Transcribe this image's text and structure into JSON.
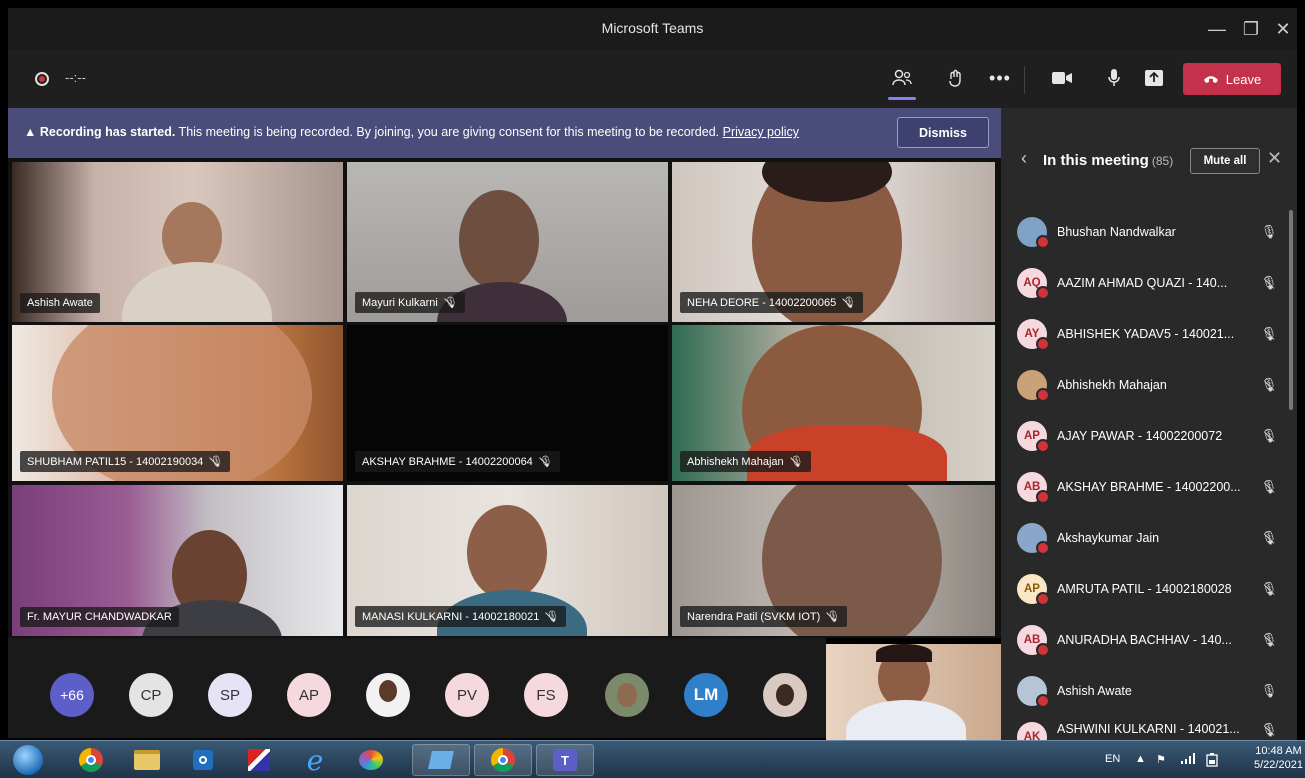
{
  "window": {
    "title": "Microsoft Teams",
    "controls": [
      "—",
      "❐",
      "✕"
    ]
  },
  "meeting_bar": {
    "timer": "--:--",
    "icons": [
      "participants-icon",
      "reactions-icon",
      "more-options-icon",
      "camera-icon",
      "microphone-icon",
      "share-screen-icon"
    ],
    "leave_label": "Leave",
    "leave_color": "#c4314b"
  },
  "banner": {
    "bold": "Recording has started.",
    "text": " This meeting is being recorded. By joining, you are giving consent for this meeting to be recorded. ",
    "link": "Privacy policy",
    "dismiss": "Dismiss",
    "color": "#4a4c7a"
  },
  "tiles": [
    {
      "name": "Ashish Awate",
      "muted": false
    },
    {
      "name": "Mayuri Kulkarni",
      "muted": true
    },
    {
      "name": "NEHA DEORE - 14002200065",
      "muted": true
    },
    {
      "name": "SHUBHAM PATIL15 - 14002190034",
      "muted": true
    },
    {
      "name": "AKSHAY BRAHME - 14002200064",
      "muted": true
    },
    {
      "name": "Abhishekh Mahajan",
      "muted": true
    },
    {
      "name": "Fr. MAYUR CHANDWADKAR",
      "muted": false
    },
    {
      "name": "MANASI KULKARNI - 14002180021",
      "muted": true
    },
    {
      "name": "Narendra Patil (SVKM IOT)",
      "muted": true
    }
  ],
  "avatar_strip": [
    {
      "label": "+66",
      "color": "#5b5fc7"
    },
    {
      "label": "CP",
      "color": "#e4e4e4"
    },
    {
      "label": "SP",
      "color": "#e6e3f7"
    },
    {
      "label": "AP",
      "color": "#f6d9de"
    },
    {
      "label": "",
      "color": "#f2f2f2"
    },
    {
      "label": "PV",
      "color": "#f6d9de"
    },
    {
      "label": "FS",
      "color": "#f6d9de"
    },
    {
      "label": "",
      "color": "#7a8a6a"
    },
    {
      "label": "LM",
      "color": "#2f80c9"
    },
    {
      "label": "",
      "color": "#d9c9c0"
    }
  ],
  "panel": {
    "title": "In this meeting",
    "count": "(85)",
    "mute_all": "Mute all",
    "participants": [
      {
        "initials": "",
        "name": "Bhushan Nandwalkar",
        "muted": false,
        "color": "#7fa2c7"
      },
      {
        "initials": "AQ",
        "name": "AAZIM AHMAD QUAZI - 140...",
        "muted": true,
        "color": "#f6d9de"
      },
      {
        "initials": "AY",
        "name": "ABHISHEK YADAV5 - 140021...",
        "muted": true,
        "color": "#f6d9de"
      },
      {
        "initials": "",
        "name": "Abhishekh Mahajan",
        "muted": true,
        "color": "#c9a27a"
      },
      {
        "initials": "AP",
        "name": "AJAY PAWAR - 14002200072",
        "muted": true,
        "color": "#f6d9de"
      },
      {
        "initials": "AB",
        "name": "AKSHAY BRAHME - 14002200...",
        "muted": true,
        "color": "#f6d9de"
      },
      {
        "initials": "",
        "name": "Akshaykumar Jain",
        "muted": true,
        "color": "#8aa7c9"
      },
      {
        "initials": "AP",
        "name": "AMRUTA PATIL - 14002180028",
        "muted": true,
        "color": "#fbe7c6"
      },
      {
        "initials": "AB",
        "name": "ANURADHA BACHHAV - 140...",
        "muted": true,
        "color": "#f6d9de"
      },
      {
        "initials": "",
        "name": "Ashish Awate",
        "muted": false,
        "color": "#b5c4d6"
      },
      {
        "initials": "AK",
        "name": "ASHWINI KULKARNI - 140021...",
        "muted": true,
        "color": "#f6d9de"
      }
    ]
  },
  "taskbar": {
    "lang": "EN",
    "time": "10:48 AM",
    "date": "5/22/2021"
  }
}
